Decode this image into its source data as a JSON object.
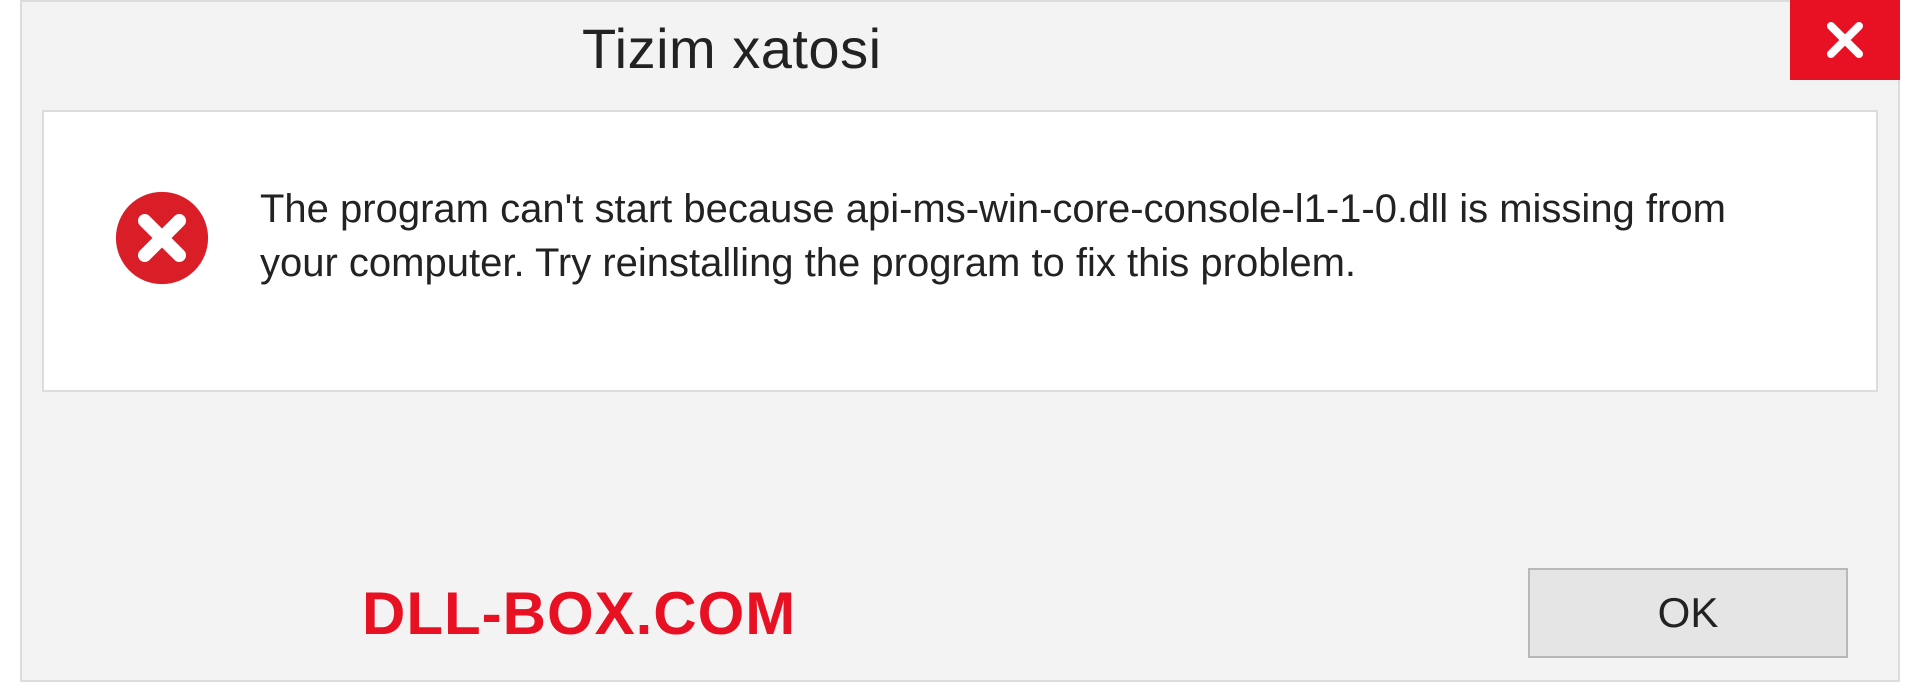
{
  "dialog": {
    "title": "Tizim xatosi",
    "message": "The program can't start because api-ms-win-core-console-l1-1-0.dll is missing from your computer. Try reinstalling the program to fix this problem.",
    "ok_label": "OK",
    "watermark": "DLL-BOX.COM"
  },
  "colors": {
    "close_bg": "#e81123",
    "error_icon": "#da1e28",
    "watermark_color": "#e81123"
  }
}
